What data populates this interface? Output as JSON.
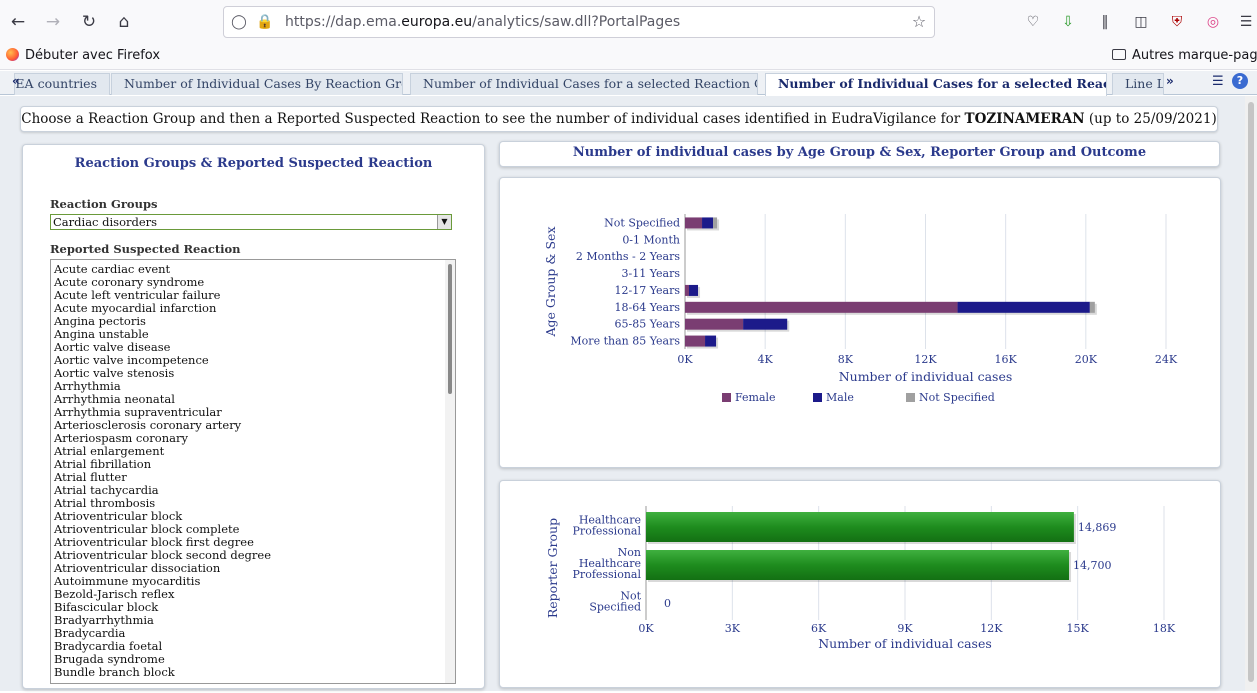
{
  "browser": {
    "url_prefix": "https://dap.ema.",
    "url_domain": "europa.eu",
    "url_suffix": "/analytics/saw.dll?PortalPages",
    "bookmark_left": "Débuter avec Firefox",
    "bookmark_right": "Autres marque-pages"
  },
  "tabs": [
    {
      "label": "EEA countries"
    },
    {
      "label": "Number of Individual Cases By Reaction Groups"
    },
    {
      "label": "Number of Individual Cases for a selected Reaction Group"
    },
    {
      "label": "Number of Individual Cases for a selected Reaction"
    },
    {
      "label": "Line Listing"
    }
  ],
  "banner": {
    "text_before": "Choose a Reaction Group and then a Reported Suspected Reaction to see the number of individual cases identified in EudraVigilance for ",
    "drug": "TOZINAMERAN",
    "text_after": " (up to 25/09/2021)"
  },
  "left_panel": {
    "title": "Reaction Groups & Reported Suspected Reaction",
    "groups_label": "Reaction Groups",
    "selected_group": "Cardiac disorders",
    "reactions_label": "Reported Suspected Reaction",
    "reactions": [
      "Acute cardiac event",
      "Acute coronary syndrome",
      "Acute left ventricular failure",
      "Acute myocardial infarction",
      "Angina pectoris",
      "Angina unstable",
      "Aortic valve disease",
      "Aortic valve incompetence",
      "Aortic valve stenosis",
      "Arrhythmia",
      "Arrhythmia neonatal",
      "Arrhythmia supraventricular",
      "Arteriosclerosis coronary artery",
      "Arteriospasm coronary",
      "Atrial enlargement",
      "Atrial fibrillation",
      "Atrial flutter",
      "Atrial tachycardia",
      "Atrial thrombosis",
      "Atrioventricular block",
      "Atrioventricular block complete",
      "Atrioventricular block first degree",
      "Atrioventricular block second degree",
      "Atrioventricular dissociation",
      "Autoimmune myocarditis",
      "Bezold-Jarisch reflex",
      "Bifascicular block",
      "Bradyarrhythmia",
      "Bradycardia",
      "Bradycardia foetal",
      "Brugada syndrome",
      "Bundle branch block"
    ]
  },
  "right_header": {
    "title": "Number of individual cases by Age Group & Sex, Reporter Group and Outcome"
  },
  "chart_data": [
    {
      "type": "bar",
      "orientation": "horizontal",
      "stacked": true,
      "categories": [
        "Not Specified",
        "0-1 Month",
        "2 Months - 2 Years",
        "3-11 Years",
        "12-17 Years",
        "18-64 Years",
        "65-85 Years",
        "More than 85 Years"
      ],
      "series": [
        {
          "name": "Female",
          "color": "#7a3d72",
          "values": [
            850,
            0,
            0,
            0,
            200,
            13600,
            2900,
            1000
          ]
        },
        {
          "name": "Male",
          "color": "#1c1a8a",
          "values": [
            550,
            0,
            0,
            0,
            450,
            6600,
            2200,
            550
          ]
        },
        {
          "name": "Not Specified",
          "color": "#a0a0a0",
          "values": [
            200,
            0,
            0,
            0,
            0,
            250,
            0,
            0
          ]
        }
      ],
      "xlabel": "Number of individual cases",
      "ylabel": "Age Group & Sex",
      "xlim": [
        0,
        24000
      ],
      "xticks": [
        "0K",
        "4K",
        "8K",
        "12K",
        "16K",
        "20K",
        "24K"
      ],
      "grid": true,
      "legend": "bottom"
    },
    {
      "type": "bar",
      "orientation": "horizontal",
      "categories": [
        [
          "Healthcare",
          "Professional"
        ],
        [
          "Non",
          "Healthcare",
          "Professional"
        ],
        [
          "Not",
          "Specified"
        ]
      ],
      "series": [
        {
          "color": "#1e8c1e",
          "values": [
            14869,
            14700,
            0
          ]
        }
      ],
      "data_labels": [
        "14,869",
        "14,700",
        "0"
      ],
      "xlabel": "Number of individual cases",
      "ylabel": "Reporter Group",
      "xlim": [
        0,
        18000
      ],
      "xticks": [
        "0K",
        "3K",
        "6K",
        "9K",
        "12K",
        "15K",
        "18K"
      ],
      "grid": true
    }
  ]
}
